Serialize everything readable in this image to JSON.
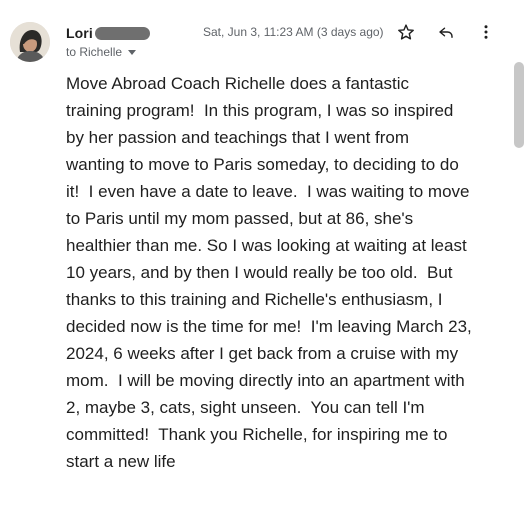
{
  "sender": {
    "name": "Lori",
    "recipient_text": "to Richelle"
  },
  "timestamp": "Sat, Jun 3, 11:23 AM (3 days ago)",
  "icons": {
    "star": "star-icon",
    "reply": "reply-icon",
    "more": "more-vertical-icon",
    "caret": "chevron-down-icon"
  },
  "message": {
    "lines": [
      "Move Abroad Coach Richelle does a fantastic",
      "training program!  In this program, I was so inspired",
      "by her passion and teachings that I went from",
      "wanting to move to Paris someday, to deciding to do",
      "it!  I even have a date to leave.  I was waiting to move",
      "to Paris until my mom passed, but at 86, she's",
      "healthier than me. So I was looking at waiting at least",
      "10 years, and by then I would really be too old.  But",
      "thanks to this training and Richelle's enthusiasm, I",
      "decided now is the time for me!  I'm leaving March 23,",
      "2024, 6 weeks after I get back from a cruise with my",
      "mom.  I will be moving directly into an apartment with",
      "2, maybe 3, cats, sight unseen.  You can tell I'm",
      "committed!  Thank you Richelle, for inspiring me to",
      "start a new life"
    ]
  },
  "colors": {
    "text": "#1f1f1f",
    "secondary_text": "#5f6368",
    "redaction": "#6f6f6f",
    "scrollbar_thumb": "#c7c7c7"
  }
}
